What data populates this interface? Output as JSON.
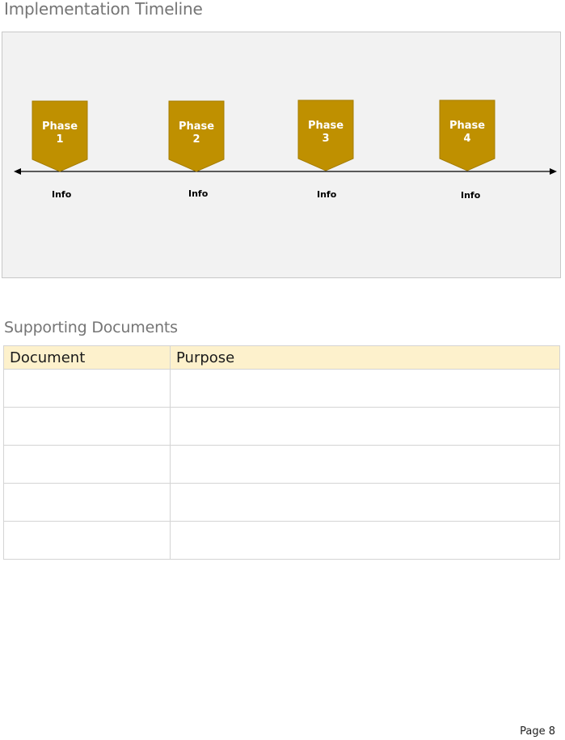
{
  "headings": {
    "timeline": "Implementation Timeline",
    "documents": "Supporting Documents"
  },
  "timeline": {
    "phases": [
      {
        "label_line1": "Phase",
        "label_line2": "1",
        "info": "Info"
      },
      {
        "label_line1": "Phase",
        "label_line2": "2",
        "info": "Info"
      },
      {
        "label_line1": "Phase",
        "label_line2": "3",
        "info": "Info"
      },
      {
        "label_line1": "Phase",
        "label_line2": "4",
        "info": "Info"
      }
    ],
    "phase_color": "#bf9000"
  },
  "documents_table": {
    "headers": [
      "Document",
      "Purpose"
    ],
    "rows": [
      [
        "",
        ""
      ],
      [
        "",
        ""
      ],
      [
        "",
        ""
      ],
      [
        "",
        ""
      ],
      [
        "",
        ""
      ]
    ],
    "header_color": "#fdf1cc"
  },
  "footer": {
    "page": "Page 8"
  }
}
